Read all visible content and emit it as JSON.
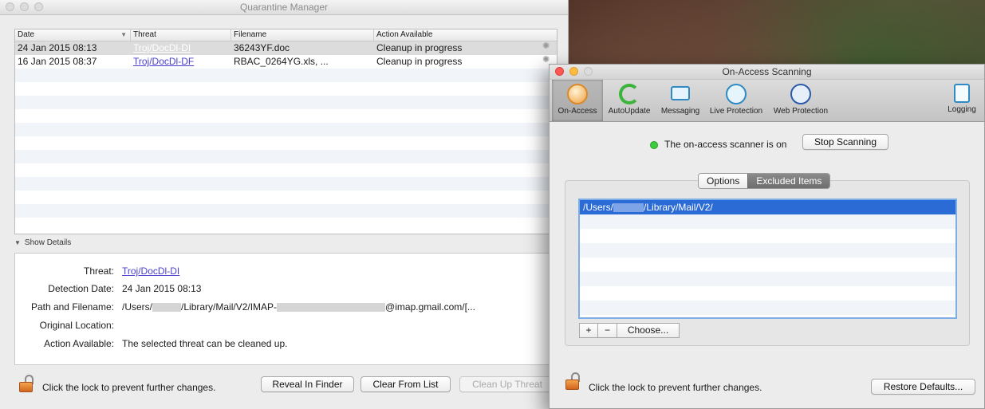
{
  "quarantine": {
    "title": "Quarantine Manager",
    "columns": [
      "Date",
      "Threat",
      "Filename",
      "Action Available"
    ],
    "rows": [
      {
        "date": "24 Jan 2015 08:13",
        "threat": "Troj/DocDl-DI",
        "filename": "36243YF.doc",
        "action": "Cleanup in progress"
      },
      {
        "date": "16 Jan 2015 08:37",
        "threat": "Troj/DocDl-DF",
        "filename": "RBAC_0264YG.xls, ...",
        "action": "Cleanup in progress"
      }
    ],
    "details_toggle": "Show Details",
    "details": {
      "threat_label": "Threat:",
      "threat_value": "Troj/DocDl-DI",
      "date_label": "Detection Date:",
      "date_value": "24 Jan 2015 08:13",
      "path_label": "Path and Filename:",
      "path_prefix": "/Users/",
      "path_middle": "/Library/Mail/V2/IMAP-",
      "path_suffix": "@imap.gmail.com/[...",
      "origin_label": "Original Location:",
      "action_label": "Action Available:",
      "action_value": "The selected threat can be cleaned up."
    },
    "lock_text": "Click the lock to prevent further changes.",
    "buttons": {
      "reveal": "Reveal In Finder",
      "clear": "Clear From List",
      "cleanup": "Clean Up Threat"
    }
  },
  "onaccess": {
    "title": "On-Access Scanning",
    "toolbar": {
      "on_access": "On-Access",
      "autoupdate": "AutoUpdate",
      "messaging": "Messaging",
      "live_protection": "Live Protection",
      "web_protection": "Web Protection",
      "logging": "Logging"
    },
    "status_text": "The on-access scanner is on",
    "stop_button": "Stop Scanning",
    "tabs": {
      "options": "Options",
      "excluded": "Excluded Items"
    },
    "excluded_items": [
      {
        "prefix": "/Users/",
        "suffix": "/Library/Mail/V2/"
      }
    ],
    "add_button": "+",
    "remove_button": "−",
    "choose_button": "Choose...",
    "lock_text": "Click the lock to prevent further changes.",
    "restore_button": "Restore Defaults..."
  }
}
